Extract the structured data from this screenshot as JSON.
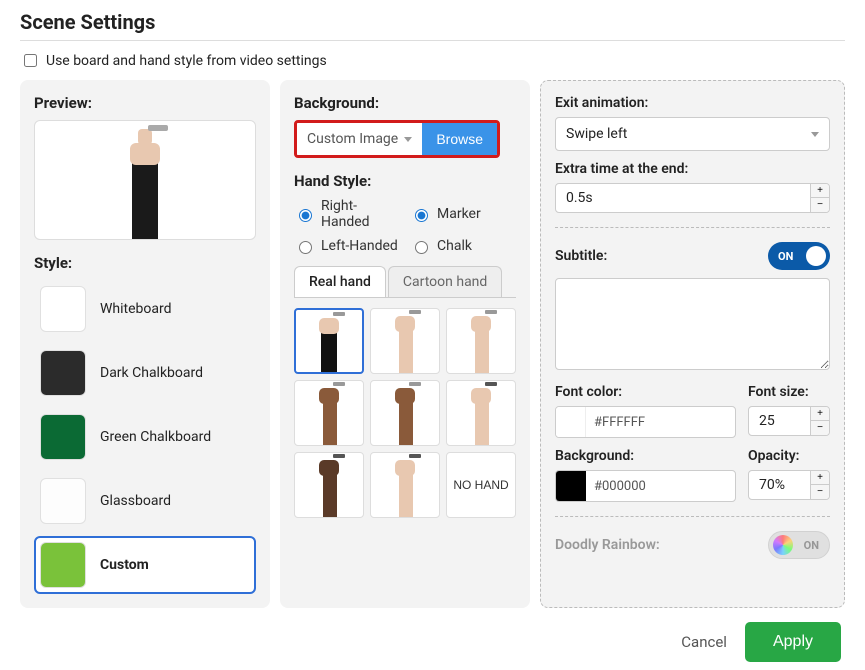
{
  "title": "Scene Settings",
  "use_video_settings_label": "Use board and hand style from video settings",
  "use_video_settings_checked": false,
  "preview_label": "Preview:",
  "style_label": "Style:",
  "styles": [
    {
      "label": "Whiteboard",
      "swatch": "white",
      "selected": false
    },
    {
      "label": "Dark Chalkboard",
      "swatch": "dark",
      "selected": false
    },
    {
      "label": "Green Chalkboard",
      "swatch": "green",
      "selected": false
    },
    {
      "label": "Glassboard",
      "swatch": "glass",
      "selected": false
    },
    {
      "label": "Custom",
      "swatch": "custom",
      "selected": true
    }
  ],
  "background_label": "Background:",
  "background_selected": "Custom Image",
  "browse_label": "Browse",
  "hand_style_label": "Hand Style:",
  "hand_orientation": {
    "right": {
      "label": "Right-Handed",
      "checked": true
    },
    "left": {
      "label": "Left-Handed",
      "checked": false
    }
  },
  "tool": {
    "marker": {
      "label": "Marker",
      "checked": true
    },
    "chalk": {
      "label": "Chalk",
      "checked": false
    }
  },
  "hand_tabs": {
    "real": {
      "label": "Real hand",
      "active": true
    },
    "cartoon": {
      "label": "Cartoon hand",
      "active": false
    }
  },
  "no_hand_label": "NO HAND",
  "exit_animation_label": "Exit animation:",
  "exit_animation_value": "Swipe left",
  "extra_time_label": "Extra time at the end:",
  "extra_time_value": "0.5s",
  "subtitle_label": "Subtitle:",
  "subtitle_toggle": {
    "state": "on",
    "label": "ON"
  },
  "subtitle_text": "",
  "font_color_label": "Font color:",
  "font_color_value": "#FFFFFF",
  "font_size_label": "Font size:",
  "font_size_value": "25",
  "bg_color_label": "Background:",
  "bg_color_value": "#000000",
  "opacity_label": "Opacity:",
  "opacity_value": "70%",
  "rainbow_label": "Doodly Rainbow:",
  "rainbow_toggle": {
    "state": "off",
    "label": "ON"
  },
  "cancel_label": "Cancel",
  "apply_label": "Apply"
}
